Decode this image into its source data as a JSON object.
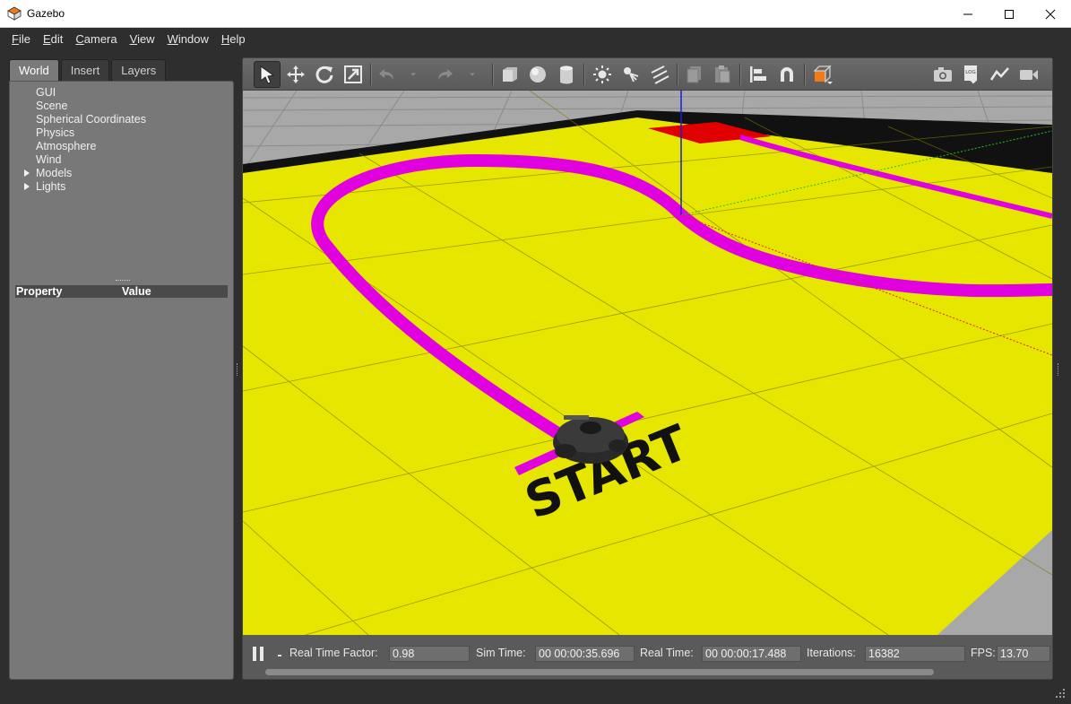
{
  "window": {
    "title": "Gazebo",
    "controls": [
      "minimize-icon",
      "maximize-icon",
      "close-icon"
    ]
  },
  "menu": [
    "File",
    "Edit",
    "Camera",
    "View",
    "Window",
    "Help"
  ],
  "left_panel": {
    "tabs": [
      "World",
      "Insert",
      "Layers"
    ],
    "active_tab": "World",
    "tree": [
      {
        "label": "GUI",
        "expandable": false
      },
      {
        "label": "Scene",
        "expandable": false
      },
      {
        "label": "Spherical Coordinates",
        "expandable": false
      },
      {
        "label": "Physics",
        "expandable": false
      },
      {
        "label": "Atmosphere",
        "expandable": false
      },
      {
        "label": "Wind",
        "expandable": false
      },
      {
        "label": "Models",
        "expandable": true
      },
      {
        "label": "Lights",
        "expandable": true
      }
    ],
    "property_header": {
      "property": "Property",
      "value": "Value"
    }
  },
  "toolbar": {
    "tools": [
      "select-arrow-icon",
      "translate-icon",
      "rotate-icon",
      "scale-icon",
      "undo-icon",
      "undo-dropdown-icon",
      "redo-icon",
      "redo-dropdown-icon",
      "box-icon",
      "sphere-icon",
      "cylinder-icon",
      "point-light-icon",
      "spot-light-icon",
      "directional-light-icon",
      "copy-icon",
      "paste-icon",
      "align-icon",
      "snap-icon",
      "view-angle-icon",
      "screenshot-icon",
      "log-icon",
      "plot-icon",
      "record-video-icon"
    ],
    "active_tool": "select-arrow-icon"
  },
  "scene": {
    "floor_color": "#e6e600",
    "track_color": "#ff00ff",
    "ground_color": "#a8a8a8",
    "finish_color": "#e00000",
    "floor_label": "START"
  },
  "status": {
    "real_time_factor_label": "Real Time Factor:",
    "real_time_factor": "0.98",
    "sim_time_label": "Sim Time:",
    "sim_time": "00 00:00:35.696",
    "real_time_label": "Real Time:",
    "real_time": "00 00:00:17.488",
    "iterations_label": "Iterations:",
    "iterations": "16382",
    "fps_label": "FPS:",
    "fps": "13.70"
  }
}
